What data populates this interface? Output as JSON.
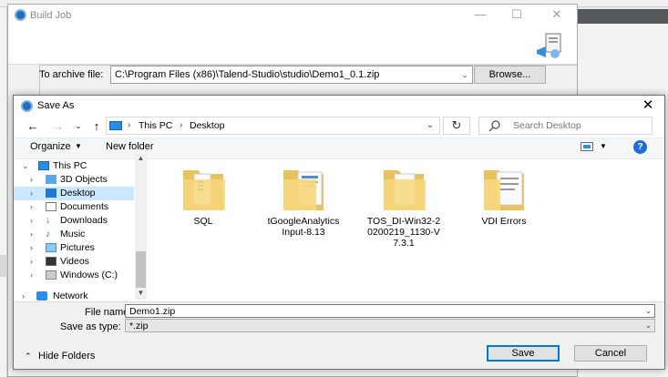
{
  "build_job": {
    "title": "Build Job",
    "archive_label": "To archive file:",
    "archive_value": "C:\\Program Files (x86)\\Talend-Studio\\studio\\Demo1_0.1.zip",
    "browse_label": "Browse..."
  },
  "save_as": {
    "title": "Save As",
    "breadcrumb": [
      "This PC",
      "Desktop"
    ],
    "search_placeholder": "Search Desktop",
    "toolbar": {
      "organize": "Organize",
      "new_folder": "New folder"
    },
    "tree": [
      {
        "label": "This PC",
        "icon": "pc-icon",
        "expanded": true
      },
      {
        "label": "3D Objects",
        "icon": "3d-objects-icon"
      },
      {
        "label": "Desktop",
        "icon": "desktop-icon",
        "selected": true
      },
      {
        "label": "Documents",
        "icon": "documents-icon"
      },
      {
        "label": "Downloads",
        "icon": "downloads-icon"
      },
      {
        "label": "Music",
        "icon": "music-icon"
      },
      {
        "label": "Pictures",
        "icon": "pictures-icon"
      },
      {
        "label": "Videos",
        "icon": "videos-icon"
      },
      {
        "label": "Windows (C:)",
        "icon": "drive-icon"
      },
      {
        "label": "Network",
        "icon": "network-icon"
      }
    ],
    "files": [
      {
        "label": "SQL",
        "icon": "folder-icon"
      },
      {
        "label": "tGoogleAnalytics\nInput-8.13",
        "icon": "folder-icon"
      },
      {
        "label": "TOS_DI-Win32-2\n0200219_1130-V\n7.3.1",
        "icon": "folder-icon"
      },
      {
        "label": "VDI Errors",
        "icon": "folder-icon"
      }
    ],
    "file_name_label": "File name:",
    "file_name_value": "Demo1.zip",
    "save_type_label": "Save as type:",
    "save_type_value": "*.zip",
    "hide_folders": "Hide Folders",
    "save_button": "Save",
    "cancel_button": "Cancel"
  }
}
